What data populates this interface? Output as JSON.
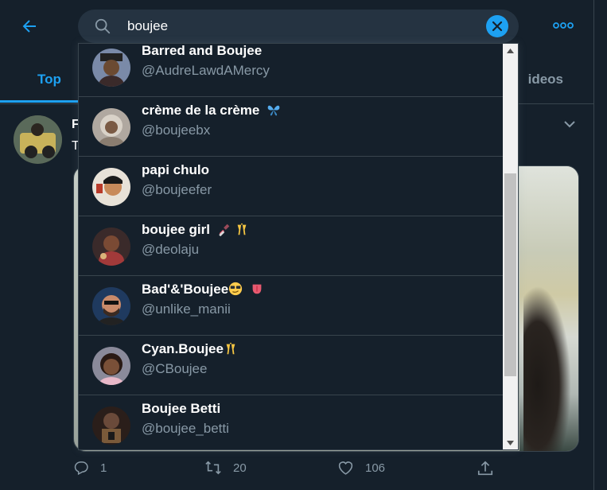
{
  "header": {
    "search_value": "boujee",
    "back_icon": "back-arrow-icon",
    "clear_icon": "close-icon",
    "more_icon": "more-horizontal-icon"
  },
  "tabs": {
    "active": "Top",
    "partial": "ideos"
  },
  "tweet": {
    "name_fragment": "F",
    "text_fragment": "T"
  },
  "actions": {
    "replies": "1",
    "retweets": "20",
    "likes": "106"
  },
  "results": [
    {
      "name": "Barred and Boujee",
      "handle": "@AudreLawdAMercy",
      "emoji": []
    },
    {
      "name": "crème de la crème",
      "handle": "@boujeebx",
      "emoji": [
        "butterfly"
      ]
    },
    {
      "name": "papi chulo",
      "handle": "@boujeefer",
      "emoji": []
    },
    {
      "name": "boujee girl",
      "handle": "@deolaju",
      "emoji": [
        "nail-polish",
        "clinking-glasses"
      ]
    },
    {
      "name": "Bad'&'Boujee",
      "handle": "@unlike_manii",
      "emoji": [
        "sunglasses-face",
        "tongue"
      ]
    },
    {
      "name": "Cyan.Boujee",
      "handle": "@CBoujee",
      "emoji": [
        "clinking-glasses"
      ]
    },
    {
      "name": "Boujee Betti",
      "handle": "@boujee_betti",
      "emoji": []
    }
  ],
  "colors": {
    "background": "#15202b",
    "accent": "#1da1f2",
    "secondary_text": "#8899a6",
    "divider": "#38444d",
    "search_bg": "#253341"
  }
}
